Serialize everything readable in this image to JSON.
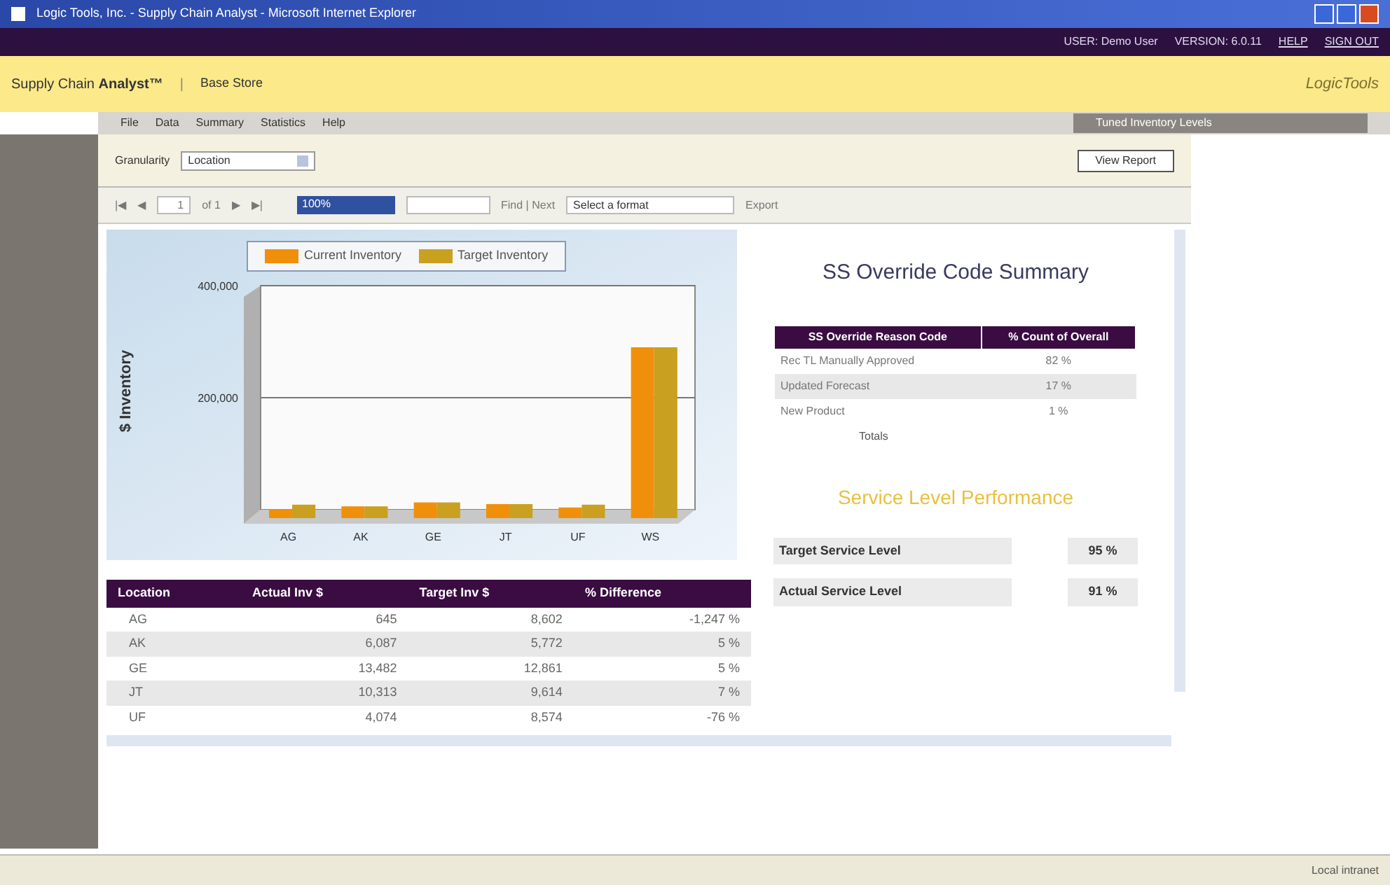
{
  "window": {
    "title": "Logic Tools, Inc. - Supply Chain Analyst - Microsoft Internet Explorer"
  },
  "user_bar": [
    "USER: Demo User",
    "VERSION: 6.0.11",
    "HELP",
    "SIGN OUT"
  ],
  "header": {
    "app_name": "Supply Chain",
    "app_name_bold": "Analyst™",
    "separator": "|",
    "store": "Base Store",
    "logo": "LogicTools"
  },
  "menu": [
    {
      "label": "File"
    },
    {
      "label": "Data"
    },
    {
      "label": "Summary"
    },
    {
      "label": "Statistics"
    },
    {
      "label": "Help"
    }
  ],
  "side_tab": "Tuned Inventory Levels",
  "filter": {
    "label": "Granularity",
    "value": "Location",
    "button": "View Report"
  },
  "toolbar": {
    "first": "|◀",
    "prev": "◀",
    "page": "1",
    "of": "of 1",
    "next": "▶",
    "last": "▶|",
    "zoom": "100%",
    "find": "Find | Next",
    "format": "Select a format",
    "export": "Export"
  },
  "chart": {
    "chart_data": {
      "type": "bar",
      "ylabel": "$ Inventory",
      "categories": [
        "AG",
        "AK",
        "GE",
        "JT",
        "UF",
        "WS"
      ],
      "series": [
        {
          "name": "Current Inventory",
          "color": "#f0900a",
          "values": [
            1000,
            6000,
            13000,
            10000,
            4000,
            290000
          ]
        },
        {
          "name": "Target Inventory",
          "color": "#c9a020",
          "values": [
            9000,
            6000,
            13000,
            10000,
            9000,
            290000
          ]
        }
      ],
      "ylim": [
        0,
        400000
      ],
      "yticks": [
        {
          "value": 200000,
          "label": "200,000"
        },
        {
          "value": 400000,
          "label": "400,000"
        }
      ],
      "legend": "top"
    }
  },
  "location_table": {
    "columns": [
      "Location",
      "Actual Inv $",
      "Target Inv $",
      "% Difference"
    ],
    "rows": [
      [
        "AG",
        "645",
        "8,602",
        "-1,247 %"
      ],
      [
        "AK",
        "6,087",
        "5,772",
        "5 %"
      ],
      [
        "GE",
        "13,482",
        "12,861",
        "5 %"
      ],
      [
        "JT",
        "10,313",
        "9,614",
        "7 %"
      ],
      [
        "UF",
        "4,074",
        "8,574",
        "-76 %"
      ]
    ]
  },
  "summary": {
    "title": "SS Override Code Summary",
    "columns": [
      "SS Override Reason Code",
      "% Count of Overall"
    ],
    "rows": [
      [
        "Rec TL Manually Approved",
        "82 %"
      ],
      [
        "Updated Forecast",
        "17 %"
      ],
      [
        "New Product",
        "1 %"
      ]
    ],
    "totals": "Totals"
  },
  "service": {
    "title": "Service Level Performance",
    "rows": [
      {
        "label": "Target Service Level",
        "value": "95 %"
      },
      {
        "label": "Actual Service Level",
        "value": "91 %"
      }
    ]
  },
  "status_bar": {
    "zone": "Local intranet"
  }
}
